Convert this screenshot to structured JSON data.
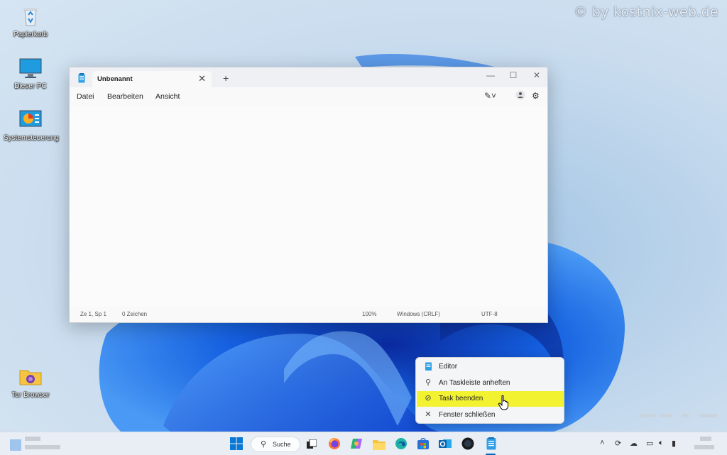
{
  "watermark": "© by kostnix-web.de",
  "desktop": {
    "icons": [
      {
        "label": "Papierkorb",
        "icon": "recycle-bin-icon"
      },
      {
        "label": "Dieser PC",
        "icon": "monitor-icon"
      },
      {
        "label": "Systemsteuerung",
        "icon": "control-panel-icon"
      },
      {
        "label": "Tor Browser",
        "icon": "folder-icon"
      }
    ]
  },
  "notepad": {
    "tab_title": "Unbenannt",
    "tab_close": "✕",
    "new_tab": "+",
    "controls": {
      "minimize": "—",
      "maximize": "☐",
      "close": "✕"
    },
    "menu": {
      "file": "Datei",
      "edit": "Bearbeiten",
      "view": "Ansicht"
    },
    "status": {
      "position": "Ze 1, Sp 1",
      "chars": "0 Zeichen",
      "zoom": "100%",
      "line_ending": "Windows (CRLF)",
      "encoding": "UTF-8"
    }
  },
  "context_menu": {
    "items": [
      {
        "label": "Editor",
        "icon": "notepad-icon"
      },
      {
        "label": "An Taskleiste anheften",
        "icon": "pin-icon"
      },
      {
        "label": "Task beenden",
        "icon": "end-task-icon",
        "highlighted": true
      },
      {
        "label": "Fenster schließen",
        "icon": "close-icon"
      }
    ]
  },
  "taskbar": {
    "search_label": "Suche",
    "apps": [
      "start-icon",
      "task-view-icon",
      "firefox-icon",
      "copilot-icon",
      "file-explorer-icon",
      "edge-icon",
      "store-icon",
      "outlook-icon",
      "app-icon",
      "notepad-icon"
    ]
  },
  "colors": {
    "highlight": "#f2f230",
    "accent": "#0067c0"
  }
}
